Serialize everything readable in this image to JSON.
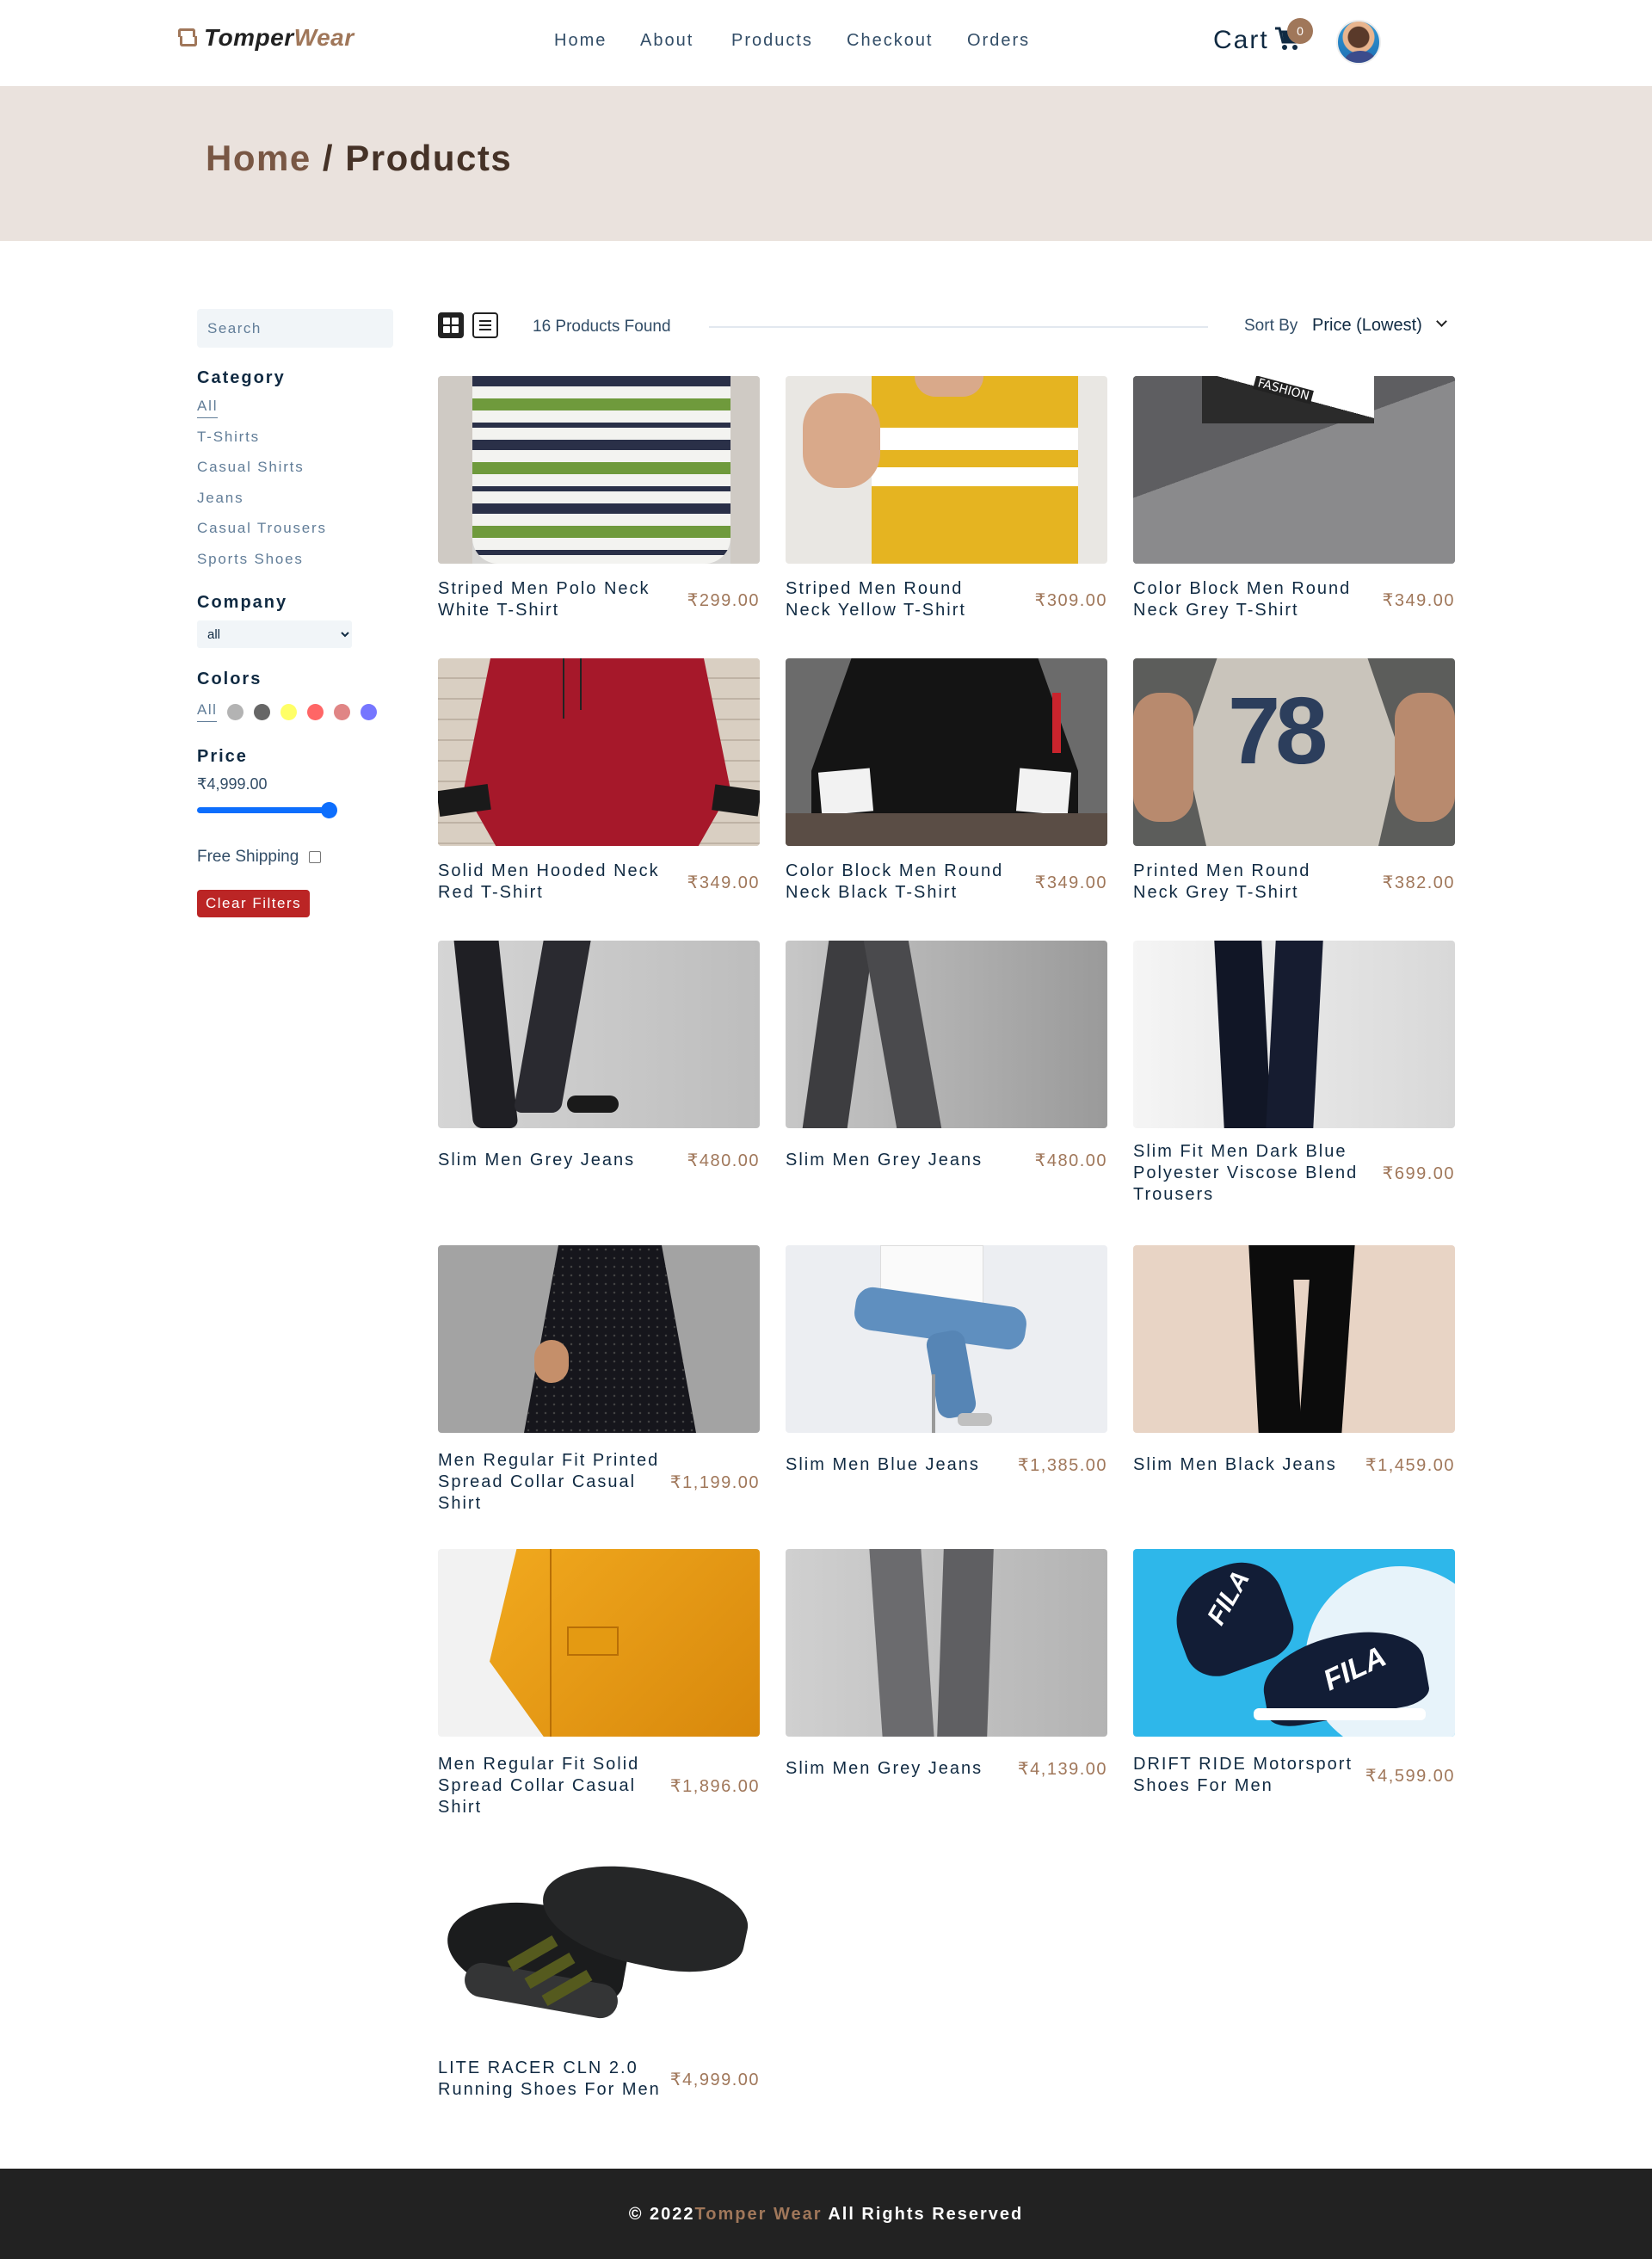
{
  "brand": {
    "name_part1": "Tomper",
    "name_part2": "Wear"
  },
  "nav": {
    "links": [
      "Home",
      "About",
      "Products",
      "Checkout",
      "Orders"
    ]
  },
  "cart": {
    "label": "Cart",
    "count": "0"
  },
  "hero": {
    "home": "Home",
    "separator": " / ",
    "current": "Products"
  },
  "filters": {
    "search_placeholder": "Search",
    "category_heading": "Category",
    "categories": [
      "All",
      "T-Shirts",
      "Casual Shirts",
      "Jeans",
      "Casual Trousers",
      "Sports Shoes"
    ],
    "company_heading": "Company",
    "company_selected": "all",
    "colors_heading": "Colors",
    "colors_all": "All",
    "colors": [
      "#808080",
      "#000000",
      "#ffff00",
      "#ff0000",
      "#cc3333",
      "#1a1aff"
    ],
    "price_heading": "Price",
    "price_value": "₹4,999.00",
    "price_level": 1.0,
    "free_shipping_label": "Free Shipping",
    "free_shipping_checked": false,
    "clear_label": "Clear Filters"
  },
  "toolbar": {
    "found": "16 Products Found",
    "sort_label": "Sort By",
    "sort_value": "Price (Lowest)"
  },
  "products": [
    {
      "name": "Striped Men Polo Neck White T-Shirt",
      "price": "₹299.00"
    },
    {
      "name": "Striped Men Round Neck Yellow T-Shirt",
      "price": "₹309.00"
    },
    {
      "name": "Color Block Men Round Neck Grey T-Shirt",
      "price": "₹349.00"
    },
    {
      "name": "Solid Men Hooded Neck Red T-Shirt",
      "price": "₹349.00"
    },
    {
      "name": "Color Block Men Round Neck Black T-Shirt",
      "price": "₹349.00"
    },
    {
      "name": "Printed Men Round Neck Grey T-Shirt",
      "price": "₹382.00"
    },
    {
      "name": "Slim Men Grey Jeans",
      "price": "₹480.00"
    },
    {
      "name": "Slim Men Grey Jeans",
      "price": "₹480.00"
    },
    {
      "name": "Slim Fit Men Dark Blue Polyester Viscose Blend Trousers",
      "price": "₹699.00"
    },
    {
      "name": "Men Regular Fit Printed Spread Collar Casual Shirt",
      "price": "₹1,199.00"
    },
    {
      "name": "Slim Men Blue Jeans",
      "price": "₹1,385.00"
    },
    {
      "name": "Slim Men Black Jeans",
      "price": "₹1,459.00"
    },
    {
      "name": "Men Regular Fit Solid Spread Collar Casual Shirt",
      "price": "₹1,896.00"
    },
    {
      "name": "Slim Men Grey Jeans",
      "price": "₹4,139.00"
    },
    {
      "name": "DRIFT RIDE Motorsport Shoes For Men",
      "price": "₹4,599.00"
    },
    {
      "name": "LITE RACER CLN 2.0 Running Shoes For Men",
      "price": "₹4,999.00"
    }
  ],
  "image_text": {
    "fashion": "FASHION",
    "fila": "FILA",
    "num78": "78"
  },
  "footer": {
    "prefix": "© 2022",
    "brand": "Tomper Wear",
    "suffix": " All Rights Reserved"
  }
}
